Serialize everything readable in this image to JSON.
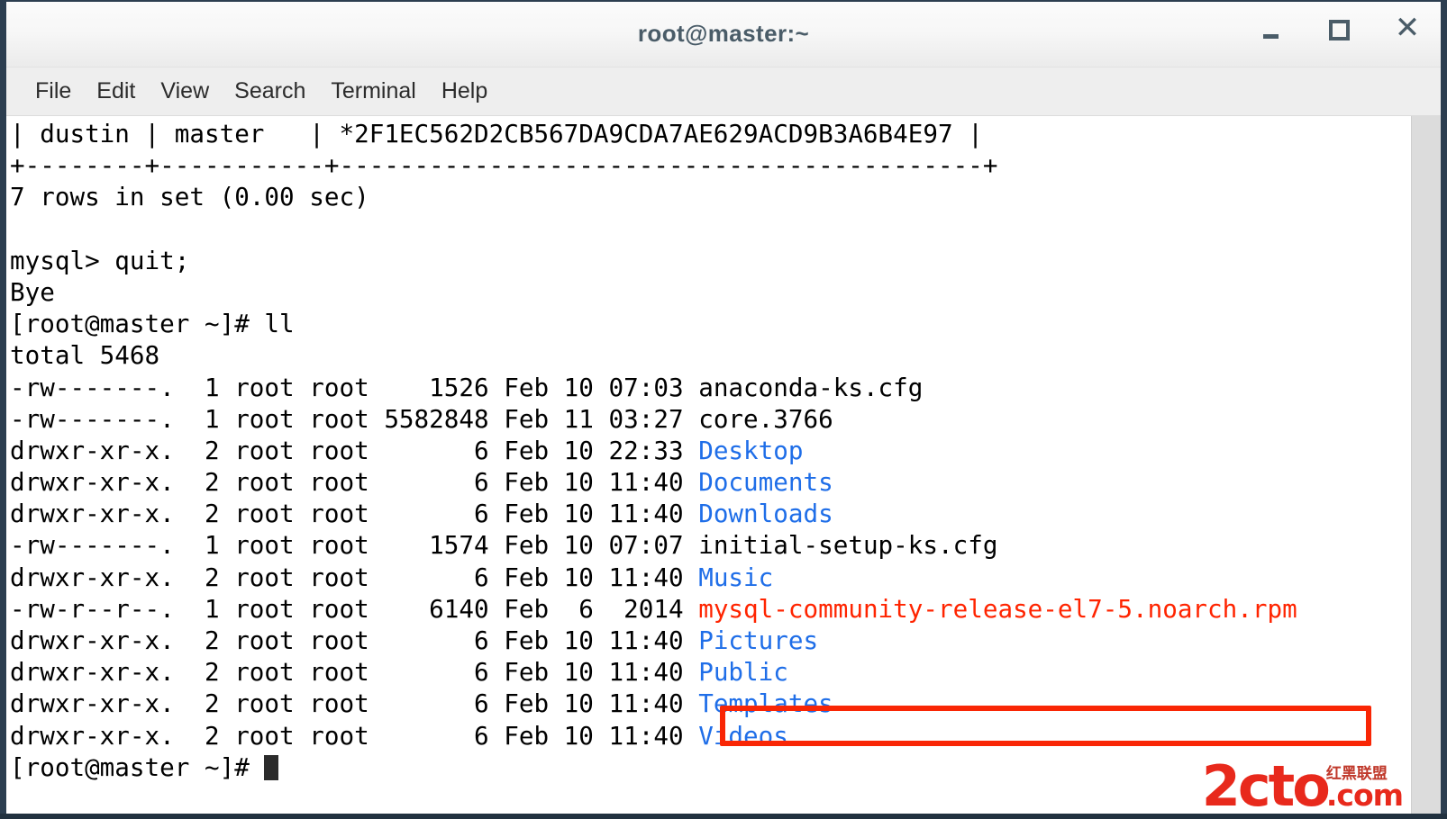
{
  "window": {
    "title": "root@master:~",
    "controls": {
      "minimize": "_",
      "maximize": "□",
      "close": "✕"
    }
  },
  "menubar": {
    "items": [
      {
        "label": "File"
      },
      {
        "label": "Edit"
      },
      {
        "label": "View"
      },
      {
        "label": "Search"
      },
      {
        "label": "Terminal"
      },
      {
        "label": "Help"
      }
    ]
  },
  "terminal": {
    "prompt": "[root@master ~]#",
    "mysql_prompt": "mysql>",
    "scrollback": {
      "table_row": "| dustin | master   | *2F1EC562D2CB567DA9CDA7AE629ACD9B3A6B4E97 |",
      "table_sep": "+--------+-----------+-------------------------------------------+",
      "rows_result": "7 rows in set (0.00 sec)",
      "blank": "",
      "quit_cmd": "mysql> quit;",
      "bye": "Bye",
      "ll_cmd": "[root@master ~]# ll",
      "total": "total 5468"
    },
    "listing": [
      {
        "perms": "-rw-------.",
        "links": "1",
        "owner": "root",
        "group": "root",
        "size": "   1526",
        "month": "Feb",
        "day": "10",
        "time": "07:03",
        "name": "anaconda-ks.cfg",
        "type": "file"
      },
      {
        "perms": "-rw-------.",
        "links": "1",
        "owner": "root",
        "group": "root",
        "size": "5582848",
        "month": "Feb",
        "day": "11",
        "time": "03:27",
        "name": "core.3766",
        "type": "file"
      },
      {
        "perms": "drwxr-xr-x.",
        "links": "2",
        "owner": "root",
        "group": "root",
        "size": "      6",
        "month": "Feb",
        "day": "10",
        "time": "22:33",
        "name": "Desktop",
        "type": "dir"
      },
      {
        "perms": "drwxr-xr-x.",
        "links": "2",
        "owner": "root",
        "group": "root",
        "size": "      6",
        "month": "Feb",
        "day": "10",
        "time": "11:40",
        "name": "Documents",
        "type": "dir"
      },
      {
        "perms": "drwxr-xr-x.",
        "links": "2",
        "owner": "root",
        "group": "root",
        "size": "      6",
        "month": "Feb",
        "day": "10",
        "time": "11:40",
        "name": "Downloads",
        "type": "dir"
      },
      {
        "perms": "-rw-------.",
        "links": "1",
        "owner": "root",
        "group": "root",
        "size": "   1574",
        "month": "Feb",
        "day": "10",
        "time": "07:07",
        "name": "initial-setup-ks.cfg",
        "type": "file"
      },
      {
        "perms": "drwxr-xr-x.",
        "links": "2",
        "owner": "root",
        "group": "root",
        "size": "      6",
        "month": "Feb",
        "day": "10",
        "time": "11:40",
        "name": "Music",
        "type": "dir"
      },
      {
        "perms": "-rw-r--r--.",
        "links": "1",
        "owner": "root",
        "group": "root",
        "size": "   6140",
        "month": "Feb",
        "day": " 6",
        "time": " 2014",
        "name": "mysql-community-release-el7-5.noarch.rpm",
        "type": "rpm"
      },
      {
        "perms": "drwxr-xr-x.",
        "links": "2",
        "owner": "root",
        "group": "root",
        "size": "      6",
        "month": "Feb",
        "day": "10",
        "time": "11:40",
        "name": "Pictures",
        "type": "dir"
      },
      {
        "perms": "drwxr-xr-x.",
        "links": "2",
        "owner": "root",
        "group": "root",
        "size": "      6",
        "month": "Feb",
        "day": "10",
        "time": "11:40",
        "name": "Public",
        "type": "dir"
      },
      {
        "perms": "drwxr-xr-x.",
        "links": "2",
        "owner": "root",
        "group": "root",
        "size": "      6",
        "month": "Feb",
        "day": "10",
        "time": "11:40",
        "name": "Templates",
        "type": "dir"
      },
      {
        "perms": "drwxr-xr-x.",
        "links": "2",
        "owner": "root",
        "group": "root",
        "size": "      6",
        "month": "Feb",
        "day": "10",
        "time": "11:40",
        "name": "Videos",
        "type": "dir"
      }
    ],
    "lines": [
      {
        "text": "| dustin | master   | *2F1EC562D2CB567DA9CDA7AE629ACD9B3A6B4E97 |",
        "color": "default"
      },
      {
        "text": "+--------+-----------+-------------------------------------------+",
        "color": "default"
      },
      {
        "text": "7 rows in set (0.00 sec)",
        "color": "default"
      },
      {
        "text": "",
        "color": "default"
      },
      {
        "text": "mysql> quit;",
        "color": "default"
      },
      {
        "text": "Bye",
        "color": "default"
      },
      {
        "text": "[root@master ~]# ll",
        "color": "default"
      },
      {
        "text": "total 5468",
        "color": "default"
      },
      {
        "prefix": "-rw-------.  1 root root    1526 Feb 10 07:03 ",
        "name": "anaconda-ks.cfg",
        "color": "default"
      },
      {
        "prefix": "-rw-------.  1 root root 5582848 Feb 11 03:27 ",
        "name": "core.3766",
        "color": "default"
      },
      {
        "prefix": "drwxr-xr-x.  2 root root       6 Feb 10 22:33 ",
        "name": "Desktop",
        "color": "dir"
      },
      {
        "prefix": "drwxr-xr-x.  2 root root       6 Feb 10 11:40 ",
        "name": "Documents",
        "color": "dir"
      },
      {
        "prefix": "drwxr-xr-x.  2 root root       6 Feb 10 11:40 ",
        "name": "Downloads",
        "color": "dir"
      },
      {
        "prefix": "-rw-------.  1 root root    1574 Feb 10 07:07 ",
        "name": "initial-setup-ks.cfg",
        "color": "default"
      },
      {
        "prefix": "drwxr-xr-x.  2 root root       6 Feb 10 11:40 ",
        "name": "Music",
        "color": "dir"
      },
      {
        "prefix": "-rw-r--r--.  1 root root    6140 Feb  6  2014 ",
        "name": "mysql-community-release-el7-5.noarch.rpm",
        "color": "rpm"
      },
      {
        "prefix": "drwxr-xr-x.  2 root root       6 Feb 10 11:40 ",
        "name": "Pictures",
        "color": "dir"
      },
      {
        "prefix": "drwxr-xr-x.  2 root root       6 Feb 10 11:40 ",
        "name": "Public",
        "color": "dir"
      },
      {
        "prefix": "drwxr-xr-x.  2 root root       6 Feb 10 11:40 ",
        "name": "Templates",
        "color": "dir"
      },
      {
        "prefix": "drwxr-xr-x.  2 root root       6 Feb 10 11:40 ",
        "name": "Videos",
        "color": "dir"
      },
      {
        "text": "[root@master ~]# ",
        "color": "default",
        "cursor": true
      }
    ],
    "colors": {
      "background": "#ffffff",
      "foreground": "#000000",
      "directory": "#1f6ee8",
      "highlight": "#f92605"
    }
  },
  "annotation": {
    "highlight_target": "mysql-community-release-el7-5.noarch.rpm",
    "box_color": "#f92605"
  },
  "watermark": {
    "brand": "2cto",
    "tld": ".com",
    "chinese": "红黑联盟"
  }
}
